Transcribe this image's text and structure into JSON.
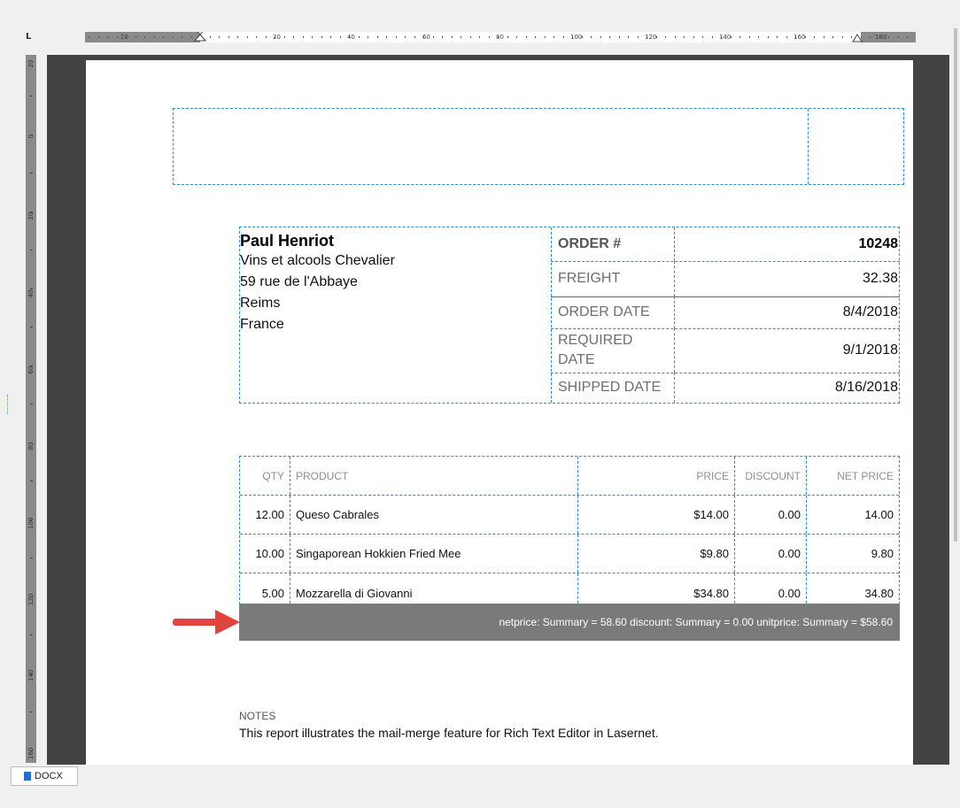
{
  "ruler": {
    "corner_glyph": "L",
    "horizontal_labels": [
      "20",
      "20",
      "40",
      "60",
      "80",
      "100",
      "120",
      "140",
      "160",
      "180"
    ],
    "vertical_labels": [
      "20",
      "0",
      "20",
      "40",
      "60",
      "80",
      "100",
      "120",
      "140",
      "160"
    ]
  },
  "address": {
    "name": "Paul Henriot",
    "lines": [
      "Vins et alcools Chevalier",
      "59 rue de l'Abbaye",
      "Reims",
      "France"
    ]
  },
  "order": {
    "number_label": "ORDER #",
    "number_value": "10248",
    "freight_label": "FREIGHT",
    "freight_value": "32.38",
    "order_date_label": "ORDER DATE",
    "order_date_value": "8/4/2018",
    "required_date_label_1": "REQUIRED",
    "required_date_label_2": "DATE",
    "required_date_value": "9/1/2018",
    "shipped_date_label": "SHIPPED DATE",
    "shipped_date_value": "8/16/2018"
  },
  "items": {
    "headers": {
      "qty": "QTY",
      "product": "PRODUCT",
      "price": "PRICE",
      "discount": "DISCOUNT",
      "net_price": "NET PRICE"
    },
    "rows": [
      {
        "qty": "12.00",
        "product": "Queso Cabrales",
        "price": "$14.00",
        "discount": "0.00",
        "net_price": "14.00"
      },
      {
        "qty": "10.00",
        "product": "Singaporean Hokkien Fried Mee",
        "price": "$9.80",
        "discount": "0.00",
        "net_price": "9.80"
      },
      {
        "qty": "5.00",
        "product": "Mozzarella di Giovanni",
        "price": "$34.80",
        "discount": "0.00",
        "net_price": "34.80"
      }
    ],
    "summary": "netprice: Summary = 58.60 discount: Summary = 0.00 unitprice: Summary = $58.60"
  },
  "notes": {
    "label": "NOTES",
    "text": "This report illustrates the mail-merge feature for Rich Text Editor in Lasernet."
  },
  "tabs": [
    {
      "label": "DOCX"
    }
  ],
  "colors": {
    "guide": "#2e8cd6",
    "summary_bg": "#7a7a7a",
    "arrow": "#e0443c",
    "workspace": "#434343"
  }
}
